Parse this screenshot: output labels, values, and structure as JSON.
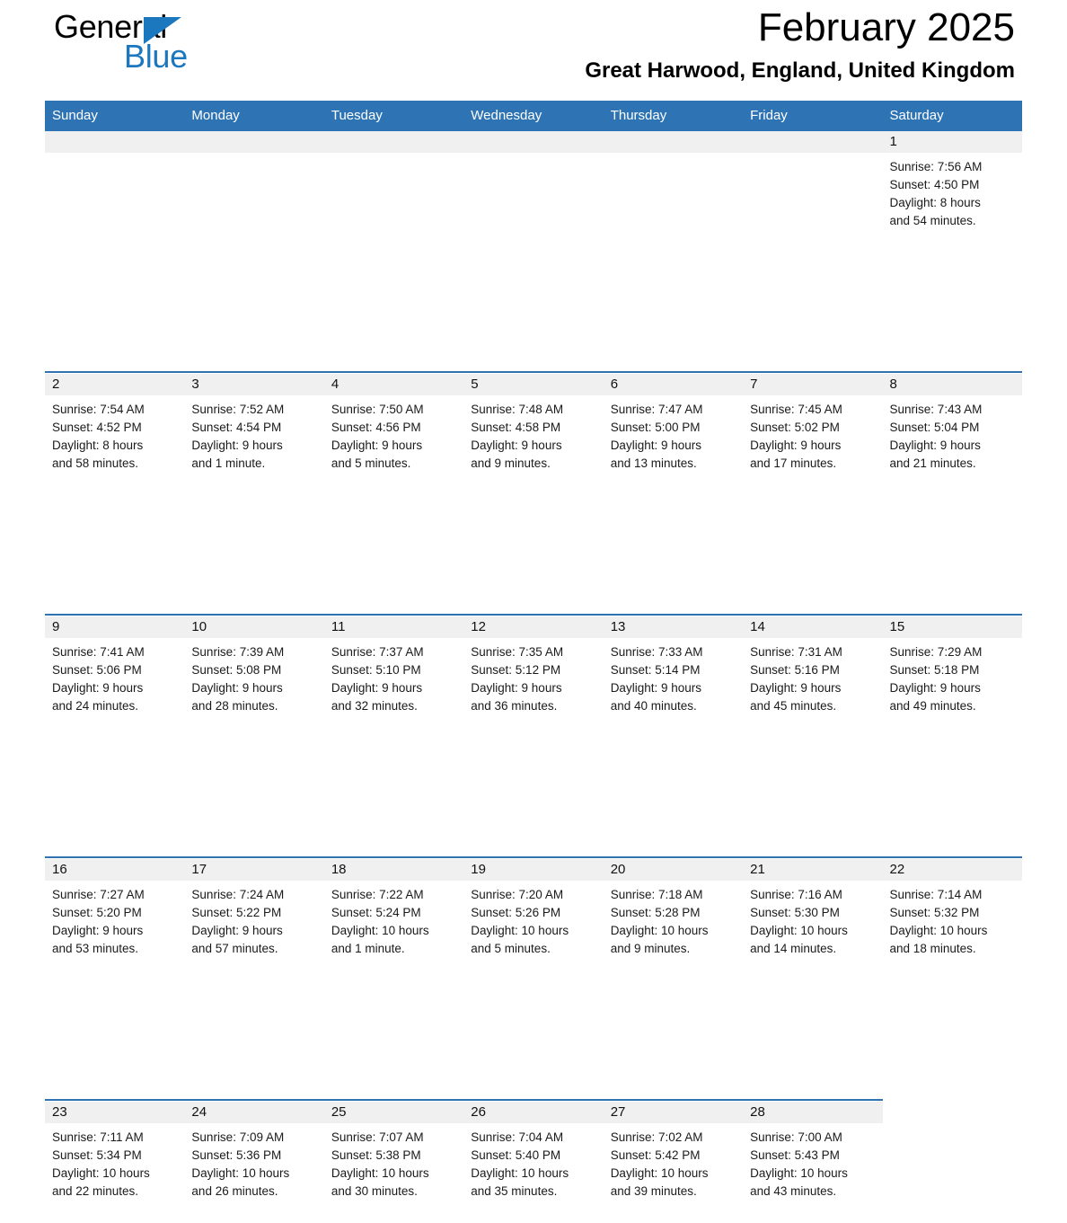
{
  "brand": {
    "name_part1": "General",
    "name_part2": "Blue",
    "triangle_color": "#1B77BE"
  },
  "header": {
    "title": "February 2025",
    "subtitle": "Great Harwood, England, United Kingdom"
  },
  "colors": {
    "header_blue": "#2E74B5",
    "row_rule_blue": "#2E74B5",
    "daynum_strip": "#F0F0F0",
    "text": "#000000"
  },
  "weekday_headers": [
    "Sunday",
    "Monday",
    "Tuesday",
    "Wednesday",
    "Thursday",
    "Friday",
    "Saturday"
  ],
  "labels": {
    "sunrise_prefix": "Sunrise:",
    "sunset_prefix": "Sunset:",
    "daylight_prefix": "Daylight:"
  },
  "weeks": [
    [
      {
        "day": "",
        "empty": true
      },
      {
        "day": "",
        "empty": true
      },
      {
        "day": "",
        "empty": true
      },
      {
        "day": "",
        "empty": true
      },
      {
        "day": "",
        "empty": true
      },
      {
        "day": "",
        "empty": true
      },
      {
        "day": "1",
        "sunrise": "Sunrise: 7:56 AM",
        "sunset": "Sunset: 4:50 PM",
        "daylight_line1": "Daylight: 8 hours",
        "daylight_line2": "and 54 minutes."
      }
    ],
    [
      {
        "day": "2",
        "sunrise": "Sunrise: 7:54 AM",
        "sunset": "Sunset: 4:52 PM",
        "daylight_line1": "Daylight: 8 hours",
        "daylight_line2": "and 58 minutes."
      },
      {
        "day": "3",
        "sunrise": "Sunrise: 7:52 AM",
        "sunset": "Sunset: 4:54 PM",
        "daylight_line1": "Daylight: 9 hours",
        "daylight_line2": "and 1 minute."
      },
      {
        "day": "4",
        "sunrise": "Sunrise: 7:50 AM",
        "sunset": "Sunset: 4:56 PM",
        "daylight_line1": "Daylight: 9 hours",
        "daylight_line2": "and 5 minutes."
      },
      {
        "day": "5",
        "sunrise": "Sunrise: 7:48 AM",
        "sunset": "Sunset: 4:58 PM",
        "daylight_line1": "Daylight: 9 hours",
        "daylight_line2": "and 9 minutes."
      },
      {
        "day": "6",
        "sunrise": "Sunrise: 7:47 AM",
        "sunset": "Sunset: 5:00 PM",
        "daylight_line1": "Daylight: 9 hours",
        "daylight_line2": "and 13 minutes."
      },
      {
        "day": "7",
        "sunrise": "Sunrise: 7:45 AM",
        "sunset": "Sunset: 5:02 PM",
        "daylight_line1": "Daylight: 9 hours",
        "daylight_line2": "and 17 minutes."
      },
      {
        "day": "8",
        "sunrise": "Sunrise: 7:43 AM",
        "sunset": "Sunset: 5:04 PM",
        "daylight_line1": "Daylight: 9 hours",
        "daylight_line2": "and 21 minutes."
      }
    ],
    [
      {
        "day": "9",
        "sunrise": "Sunrise: 7:41 AM",
        "sunset": "Sunset: 5:06 PM",
        "daylight_line1": "Daylight: 9 hours",
        "daylight_line2": "and 24 minutes."
      },
      {
        "day": "10",
        "sunrise": "Sunrise: 7:39 AM",
        "sunset": "Sunset: 5:08 PM",
        "daylight_line1": "Daylight: 9 hours",
        "daylight_line2": "and 28 minutes."
      },
      {
        "day": "11",
        "sunrise": "Sunrise: 7:37 AM",
        "sunset": "Sunset: 5:10 PM",
        "daylight_line1": "Daylight: 9 hours",
        "daylight_line2": "and 32 minutes."
      },
      {
        "day": "12",
        "sunrise": "Sunrise: 7:35 AM",
        "sunset": "Sunset: 5:12 PM",
        "daylight_line1": "Daylight: 9 hours",
        "daylight_line2": "and 36 minutes."
      },
      {
        "day": "13",
        "sunrise": "Sunrise: 7:33 AM",
        "sunset": "Sunset: 5:14 PM",
        "daylight_line1": "Daylight: 9 hours",
        "daylight_line2": "and 40 minutes."
      },
      {
        "day": "14",
        "sunrise": "Sunrise: 7:31 AM",
        "sunset": "Sunset: 5:16 PM",
        "daylight_line1": "Daylight: 9 hours",
        "daylight_line2": "and 45 minutes."
      },
      {
        "day": "15",
        "sunrise": "Sunrise: 7:29 AM",
        "sunset": "Sunset: 5:18 PM",
        "daylight_line1": "Daylight: 9 hours",
        "daylight_line2": "and 49 minutes."
      }
    ],
    [
      {
        "day": "16",
        "sunrise": "Sunrise: 7:27 AM",
        "sunset": "Sunset: 5:20 PM",
        "daylight_line1": "Daylight: 9 hours",
        "daylight_line2": "and 53 minutes."
      },
      {
        "day": "17",
        "sunrise": "Sunrise: 7:24 AM",
        "sunset": "Sunset: 5:22 PM",
        "daylight_line1": "Daylight: 9 hours",
        "daylight_line2": "and 57 minutes."
      },
      {
        "day": "18",
        "sunrise": "Sunrise: 7:22 AM",
        "sunset": "Sunset: 5:24 PM",
        "daylight_line1": "Daylight: 10 hours",
        "daylight_line2": "and 1 minute."
      },
      {
        "day": "19",
        "sunrise": "Sunrise: 7:20 AM",
        "sunset": "Sunset: 5:26 PM",
        "daylight_line1": "Daylight: 10 hours",
        "daylight_line2": "and 5 minutes."
      },
      {
        "day": "20",
        "sunrise": "Sunrise: 7:18 AM",
        "sunset": "Sunset: 5:28 PM",
        "daylight_line1": "Daylight: 10 hours",
        "daylight_line2": "and 9 minutes."
      },
      {
        "day": "21",
        "sunrise": "Sunrise: 7:16 AM",
        "sunset": "Sunset: 5:30 PM",
        "daylight_line1": "Daylight: 10 hours",
        "daylight_line2": "and 14 minutes."
      },
      {
        "day": "22",
        "sunrise": "Sunrise: 7:14 AM",
        "sunset": "Sunset: 5:32 PM",
        "daylight_line1": "Daylight: 10 hours",
        "daylight_line2": "and 18 minutes."
      }
    ],
    [
      {
        "day": "23",
        "sunrise": "Sunrise: 7:11 AM",
        "sunset": "Sunset: 5:34 PM",
        "daylight_line1": "Daylight: 10 hours",
        "daylight_line2": "and 22 minutes."
      },
      {
        "day": "24",
        "sunrise": "Sunrise: 7:09 AM",
        "sunset": "Sunset: 5:36 PM",
        "daylight_line1": "Daylight: 10 hours",
        "daylight_line2": "and 26 minutes."
      },
      {
        "day": "25",
        "sunrise": "Sunrise: 7:07 AM",
        "sunset": "Sunset: 5:38 PM",
        "daylight_line1": "Daylight: 10 hours",
        "daylight_line2": "and 30 minutes."
      },
      {
        "day": "26",
        "sunrise": "Sunrise: 7:04 AM",
        "sunset": "Sunset: 5:40 PM",
        "daylight_line1": "Daylight: 10 hours",
        "daylight_line2": "and 35 minutes."
      },
      {
        "day": "27",
        "sunrise": "Sunrise: 7:02 AM",
        "sunset": "Sunset: 5:42 PM",
        "daylight_line1": "Daylight: 10 hours",
        "daylight_line2": "and 39 minutes."
      },
      {
        "day": "28",
        "sunrise": "Sunrise: 7:00 AM",
        "sunset": "Sunset: 5:43 PM",
        "daylight_line1": "Daylight: 10 hours",
        "daylight_line2": "and 43 minutes."
      },
      {
        "day": "",
        "blank": true
      }
    ]
  ]
}
